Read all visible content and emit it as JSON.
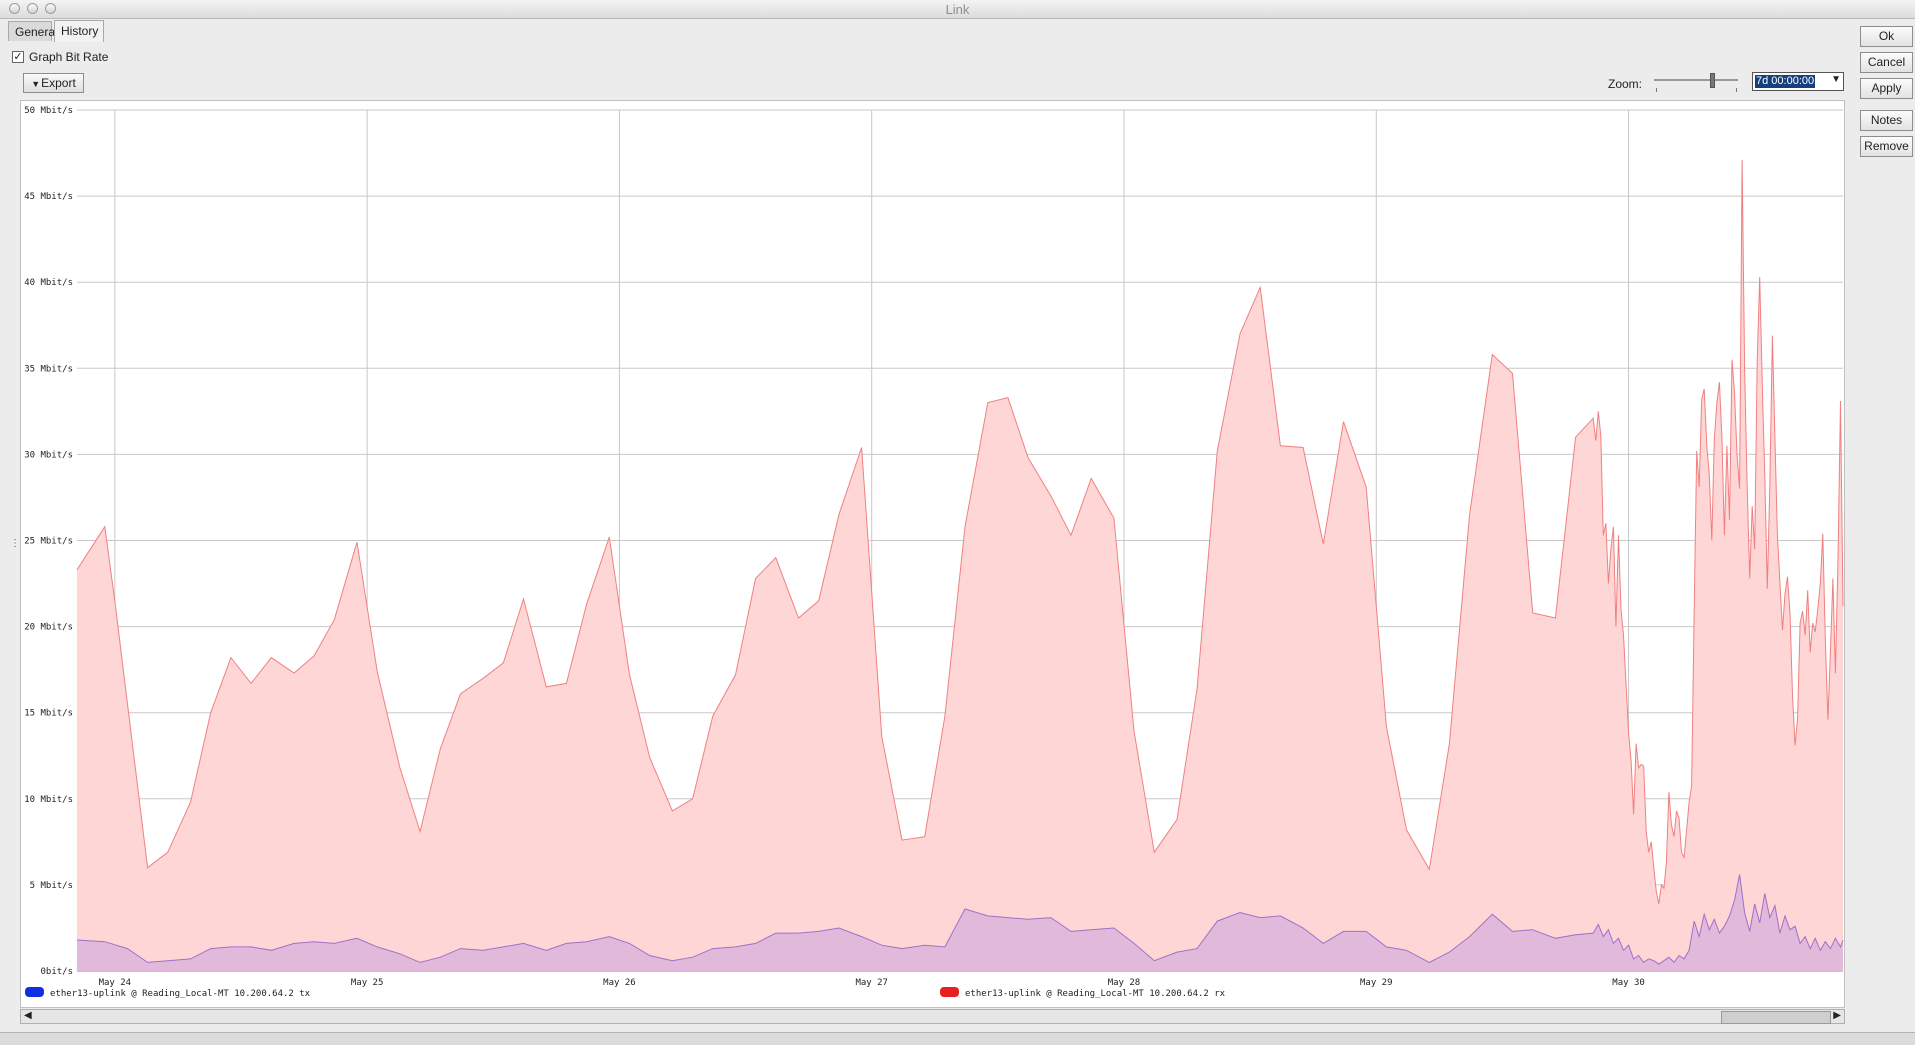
{
  "window": {
    "title": "Link"
  },
  "tabs": [
    {
      "label": "General"
    },
    {
      "label": "History"
    }
  ],
  "options": {
    "graph_bit_rate_label": "Graph Bit Rate",
    "graph_bit_rate_checked": true,
    "check_mark": "✓"
  },
  "toolbar": {
    "export_label": "Export"
  },
  "zoom": {
    "label": "Zoom:",
    "value": "7d 00:00:00"
  },
  "side_buttons": {
    "ok": "Ok",
    "cancel": "Cancel",
    "apply": "Apply",
    "notes": "Notes",
    "remove": "Remove"
  },
  "chart_data": {
    "type": "area",
    "ylim": [
      0,
      50
    ],
    "y_unit": "Mbit/s",
    "y_ticks": [
      {
        "value": 50,
        "label": "50 Mbit/s"
      },
      {
        "value": 45,
        "label": "45 Mbit/s"
      },
      {
        "value": 40,
        "label": "40 Mbit/s"
      },
      {
        "value": 35,
        "label": "35 Mbit/s"
      },
      {
        "value": 30,
        "label": "30 Mbit/s"
      },
      {
        "value": 25,
        "label": "25 Mbit/s"
      },
      {
        "value": 20,
        "label": "20 Mbit/s"
      },
      {
        "value": 15,
        "label": "15 Mbit/s"
      },
      {
        "value": 10,
        "label": "10 Mbit/s"
      },
      {
        "value": 5,
        "label": "5 Mbit/s"
      },
      {
        "value": 0,
        "label": "0bit/s"
      }
    ],
    "x_unit": "days since May 23 00:00",
    "xlim": [
      0.85,
      7.85
    ],
    "x_ticks": [
      {
        "value": 1,
        "label": "May 24"
      },
      {
        "value": 2,
        "label": "May 25"
      },
      {
        "value": 3,
        "label": "May 26"
      },
      {
        "value": 4,
        "label": "May 27"
      },
      {
        "value": 5,
        "label": "May 28"
      },
      {
        "value": 6,
        "label": "May 29"
      },
      {
        "value": 7,
        "label": "May 30"
      }
    ],
    "grid": true,
    "legend_position": "bottom",
    "series": [
      {
        "name": "ether13-uplink @ Reading_Local-MT 10.200.64.2 rx",
        "color": "#e82020",
        "fill": "#ffd6d6",
        "stroke": "#f08080",
        "points": [
          [
            0.85,
            23.3
          ],
          [
            0.96,
            25.8
          ],
          [
            1.0,
            21.5
          ],
          [
            1.13,
            6.0
          ],
          [
            1.21,
            6.9
          ],
          [
            1.3,
            9.8
          ],
          [
            1.38,
            15.0
          ],
          [
            1.46,
            18.2
          ],
          [
            1.54,
            16.7
          ],
          [
            1.62,
            18.2
          ],
          [
            1.71,
            17.3
          ],
          [
            1.79,
            18.3
          ],
          [
            1.87,
            20.4
          ],
          [
            1.96,
            24.9
          ],
          [
            2.04,
            17.4
          ],
          [
            2.13,
            11.8
          ],
          [
            2.21,
            8.1
          ],
          [
            2.29,
            12.9
          ],
          [
            2.37,
            16.1
          ],
          [
            2.46,
            17.0
          ],
          [
            2.54,
            17.9
          ],
          [
            2.62,
            21.6
          ],
          [
            2.71,
            16.5
          ],
          [
            2.79,
            16.7
          ],
          [
            2.87,
            21.3
          ],
          [
            2.96,
            25.2
          ],
          [
            3.04,
            17.2
          ],
          [
            3.12,
            12.4
          ],
          [
            3.21,
            9.3
          ],
          [
            3.29,
            10.0
          ],
          [
            3.37,
            14.8
          ],
          [
            3.46,
            17.2
          ],
          [
            3.54,
            22.8
          ],
          [
            3.62,
            24.0
          ],
          [
            3.71,
            20.5
          ],
          [
            3.79,
            21.5
          ],
          [
            3.87,
            26.5
          ],
          [
            3.96,
            30.4
          ],
          [
            4.04,
            13.6
          ],
          [
            4.12,
            7.6
          ],
          [
            4.21,
            7.8
          ],
          [
            4.29,
            14.8
          ],
          [
            4.37,
            25.8
          ],
          [
            4.46,
            33.0
          ],
          [
            4.54,
            33.3
          ],
          [
            4.62,
            29.8
          ],
          [
            4.71,
            27.6
          ],
          [
            4.79,
            25.3
          ],
          [
            4.87,
            28.6
          ],
          [
            4.96,
            26.3
          ],
          [
            5.04,
            13.9
          ],
          [
            5.12,
            6.9
          ],
          [
            5.21,
            8.8
          ],
          [
            5.29,
            16.4
          ],
          [
            5.37,
            30.2
          ],
          [
            5.46,
            37.0
          ],
          [
            5.54,
            39.7
          ],
          [
            5.62,
            30.5
          ],
          [
            5.71,
            30.4
          ],
          [
            5.79,
            24.8
          ],
          [
            5.87,
            31.9
          ],
          [
            5.96,
            28.1
          ],
          [
            6.04,
            14.2
          ],
          [
            6.12,
            8.2
          ],
          [
            6.21,
            5.9
          ],
          [
            6.29,
            13.2
          ],
          [
            6.37,
            26.5
          ],
          [
            6.46,
            35.8
          ],
          [
            6.54,
            34.7
          ],
          [
            6.62,
            20.8
          ],
          [
            6.71,
            20.5
          ],
          [
            6.79,
            31.0
          ],
          [
            6.86,
            32.1
          ],
          [
            6.87,
            30.8
          ],
          [
            6.88,
            32.5
          ],
          [
            6.89,
            31.1
          ],
          [
            6.9,
            25.3
          ],
          [
            6.91,
            26.0
          ],
          [
            6.92,
            22.5
          ],
          [
            6.93,
            24.5
          ],
          [
            6.94,
            25.8
          ],
          [
            6.95,
            20.0
          ],
          [
            6.96,
            25.3
          ],
          [
            6.97,
            21.0
          ],
          [
            6.98,
            19.5
          ],
          [
            7.0,
            13.8
          ],
          [
            7.01,
            12.2
          ],
          [
            7.02,
            9.1
          ],
          [
            7.03,
            13.2
          ],
          [
            7.04,
            11.8
          ],
          [
            7.05,
            12.0
          ],
          [
            7.06,
            11.9
          ],
          [
            7.07,
            8.1
          ],
          [
            7.08,
            6.9
          ],
          [
            7.09,
            7.5
          ],
          [
            7.1,
            6.0
          ],
          [
            7.11,
            4.6
          ],
          [
            7.12,
            3.9
          ],
          [
            7.13,
            5.0
          ],
          [
            7.14,
            4.8
          ],
          [
            7.15,
            6.3
          ],
          [
            7.16,
            10.4
          ],
          [
            7.17,
            8.5
          ],
          [
            7.18,
            7.8
          ],
          [
            7.19,
            9.3
          ],
          [
            7.2,
            8.9
          ],
          [
            7.21,
            6.9
          ],
          [
            7.22,
            6.6
          ],
          [
            7.23,
            8.2
          ],
          [
            7.24,
            9.8
          ],
          [
            7.25,
            10.7
          ],
          [
            7.26,
            21.0
          ],
          [
            7.27,
            30.2
          ],
          [
            7.28,
            28.1
          ],
          [
            7.29,
            33.2
          ],
          [
            7.3,
            33.8
          ],
          [
            7.31,
            30.5
          ],
          [
            7.32,
            28.8
          ],
          [
            7.33,
            25.0
          ],
          [
            7.34,
            30.9
          ],
          [
            7.35,
            33.0
          ],
          [
            7.36,
            34.2
          ],
          [
            7.37,
            31.0
          ],
          [
            7.38,
            25.3
          ],
          [
            7.39,
            30.5
          ],
          [
            7.4,
            26.2
          ],
          [
            7.41,
            35.5
          ],
          [
            7.42,
            33.6
          ],
          [
            7.43,
            30.0
          ],
          [
            7.44,
            28.0
          ],
          [
            7.45,
            47.1
          ],
          [
            7.46,
            35.0
          ],
          [
            7.47,
            28.3
          ],
          [
            7.48,
            22.8
          ],
          [
            7.49,
            27.0
          ],
          [
            7.5,
            24.5
          ],
          [
            7.51,
            35.4
          ],
          [
            7.52,
            40.3
          ],
          [
            7.53,
            34.0
          ],
          [
            7.54,
            28.7
          ],
          [
            7.55,
            22.2
          ],
          [
            7.56,
            28.1
          ],
          [
            7.57,
            36.9
          ],
          [
            7.58,
            31.0
          ],
          [
            7.59,
            25.3
          ],
          [
            7.6,
            22.6
          ],
          [
            7.61,
            19.8
          ],
          [
            7.62,
            21.9
          ],
          [
            7.63,
            22.9
          ],
          [
            7.64,
            20.8
          ],
          [
            7.65,
            16.0
          ],
          [
            7.66,
            13.1
          ],
          [
            7.67,
            14.7
          ],
          [
            7.68,
            20.2
          ],
          [
            7.69,
            20.9
          ],
          [
            7.7,
            19.5
          ],
          [
            7.71,
            22.1
          ],
          [
            7.72,
            18.5
          ],
          [
            7.73,
            20.2
          ],
          [
            7.74,
            19.7
          ],
          [
            7.75,
            21.0
          ],
          [
            7.76,
            22.5
          ],
          [
            7.77,
            25.4
          ],
          [
            7.78,
            19.3
          ],
          [
            7.79,
            14.6
          ],
          [
            7.8,
            18.5
          ],
          [
            7.81,
            22.8
          ],
          [
            7.82,
            17.3
          ],
          [
            7.83,
            23.9
          ],
          [
            7.84,
            33.1
          ],
          [
            7.85,
            21.2
          ]
        ]
      },
      {
        "name": "ether13-uplink @ Reading_Local-MT 10.200.64.2 tx",
        "color": "#1030e0",
        "fill": "#dcb4dc",
        "stroke": "#a070c8",
        "points": [
          [
            0.85,
            1.8
          ],
          [
            0.96,
            1.7
          ],
          [
            1.05,
            1.3
          ],
          [
            1.13,
            0.5
          ],
          [
            1.21,
            0.6
          ],
          [
            1.3,
            0.7
          ],
          [
            1.38,
            1.3
          ],
          [
            1.46,
            1.4
          ],
          [
            1.54,
            1.4
          ],
          [
            1.62,
            1.2
          ],
          [
            1.71,
            1.6
          ],
          [
            1.79,
            1.7
          ],
          [
            1.87,
            1.6
          ],
          [
            1.96,
            1.9
          ],
          [
            2.04,
            1.4
          ],
          [
            2.13,
            1.0
          ],
          [
            2.21,
            0.5
          ],
          [
            2.29,
            0.8
          ],
          [
            2.37,
            1.3
          ],
          [
            2.46,
            1.2
          ],
          [
            2.54,
            1.4
          ],
          [
            2.62,
            1.6
          ],
          [
            2.71,
            1.2
          ],
          [
            2.79,
            1.6
          ],
          [
            2.87,
            1.7
          ],
          [
            2.96,
            2.0
          ],
          [
            3.04,
            1.6
          ],
          [
            3.12,
            0.9
          ],
          [
            3.21,
            0.6
          ],
          [
            3.29,
            0.8
          ],
          [
            3.37,
            1.3
          ],
          [
            3.46,
            1.4
          ],
          [
            3.54,
            1.6
          ],
          [
            3.62,
            2.2
          ],
          [
            3.71,
            2.2
          ],
          [
            3.79,
            2.3
          ],
          [
            3.87,
            2.5
          ],
          [
            3.96,
            2.0
          ],
          [
            4.04,
            1.5
          ],
          [
            4.12,
            1.3
          ],
          [
            4.21,
            1.5
          ],
          [
            4.29,
            1.4
          ],
          [
            4.37,
            3.6
          ],
          [
            4.46,
            3.2
          ],
          [
            4.54,
            3.1
          ],
          [
            4.62,
            3.0
          ],
          [
            4.71,
            3.1
          ],
          [
            4.79,
            2.3
          ],
          [
            4.87,
            2.4
          ],
          [
            4.96,
            2.5
          ],
          [
            5.04,
            1.6
          ],
          [
            5.12,
            0.6
          ],
          [
            5.21,
            1.1
          ],
          [
            5.29,
            1.3
          ],
          [
            5.37,
            2.9
          ],
          [
            5.46,
            3.4
          ],
          [
            5.54,
            3.1
          ],
          [
            5.62,
            3.2
          ],
          [
            5.71,
            2.5
          ],
          [
            5.79,
            1.6
          ],
          [
            5.87,
            2.3
          ],
          [
            5.96,
            2.3
          ],
          [
            6.04,
            1.4
          ],
          [
            6.12,
            1.2
          ],
          [
            6.21,
            0.5
          ],
          [
            6.29,
            1.1
          ],
          [
            6.37,
            2.0
          ],
          [
            6.46,
            3.3
          ],
          [
            6.54,
            2.3
          ],
          [
            6.62,
            2.4
          ],
          [
            6.71,
            1.9
          ],
          [
            6.79,
            2.1
          ],
          [
            6.86,
            2.2
          ],
          [
            6.88,
            2.7
          ],
          [
            6.9,
            2.0
          ],
          [
            6.92,
            2.4
          ],
          [
            6.94,
            1.6
          ],
          [
            6.96,
            1.9
          ],
          [
            6.98,
            1.2
          ],
          [
            7.0,
            1.5
          ],
          [
            7.02,
            0.7
          ],
          [
            7.04,
            0.9
          ],
          [
            7.06,
            0.5
          ],
          [
            7.08,
            0.7
          ],
          [
            7.1,
            0.6
          ],
          [
            7.12,
            0.4
          ],
          [
            7.14,
            0.6
          ],
          [
            7.16,
            0.8
          ],
          [
            7.18,
            0.5
          ],
          [
            7.2,
            0.9
          ],
          [
            7.22,
            0.7
          ],
          [
            7.24,
            1.2
          ],
          [
            7.26,
            2.9
          ],
          [
            7.28,
            2.0
          ],
          [
            7.3,
            3.3
          ],
          [
            7.32,
            2.4
          ],
          [
            7.34,
            3.0
          ],
          [
            7.36,
            2.2
          ],
          [
            7.38,
            2.6
          ],
          [
            7.4,
            3.2
          ],
          [
            7.42,
            4.1
          ],
          [
            7.44,
            5.6
          ],
          [
            7.46,
            3.4
          ],
          [
            7.48,
            2.3
          ],
          [
            7.5,
            3.9
          ],
          [
            7.52,
            2.8
          ],
          [
            7.54,
            4.5
          ],
          [
            7.56,
            3.1
          ],
          [
            7.58,
            3.8
          ],
          [
            7.6,
            2.2
          ],
          [
            7.62,
            3.2
          ],
          [
            7.64,
            2.4
          ],
          [
            7.66,
            2.6
          ],
          [
            7.68,
            1.6
          ],
          [
            7.7,
            2.0
          ],
          [
            7.72,
            1.3
          ],
          [
            7.74,
            1.9
          ],
          [
            7.76,
            1.2
          ],
          [
            7.78,
            1.7
          ],
          [
            7.8,
            1.3
          ],
          [
            7.82,
            1.9
          ],
          [
            7.84,
            1.4
          ],
          [
            7.85,
            1.8
          ]
        ]
      }
    ]
  }
}
